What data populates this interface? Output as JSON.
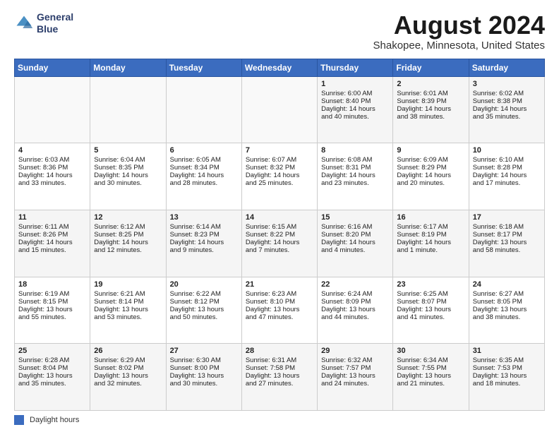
{
  "header": {
    "logo_line1": "General",
    "logo_line2": "Blue",
    "month_title": "August 2024",
    "location": "Shakopee, Minnesota, United States"
  },
  "days_of_week": [
    "Sunday",
    "Monday",
    "Tuesday",
    "Wednesday",
    "Thursday",
    "Friday",
    "Saturday"
  ],
  "weeks": [
    [
      {
        "day": "",
        "info": ""
      },
      {
        "day": "",
        "info": ""
      },
      {
        "day": "",
        "info": ""
      },
      {
        "day": "",
        "info": ""
      },
      {
        "day": "1",
        "info": "Sunrise: 6:00 AM\nSunset: 8:40 PM\nDaylight: 14 hours\nand 40 minutes."
      },
      {
        "day": "2",
        "info": "Sunrise: 6:01 AM\nSunset: 8:39 PM\nDaylight: 14 hours\nand 38 minutes."
      },
      {
        "day": "3",
        "info": "Sunrise: 6:02 AM\nSunset: 8:38 PM\nDaylight: 14 hours\nand 35 minutes."
      }
    ],
    [
      {
        "day": "4",
        "info": "Sunrise: 6:03 AM\nSunset: 8:36 PM\nDaylight: 14 hours\nand 33 minutes."
      },
      {
        "day": "5",
        "info": "Sunrise: 6:04 AM\nSunset: 8:35 PM\nDaylight: 14 hours\nand 30 minutes."
      },
      {
        "day": "6",
        "info": "Sunrise: 6:05 AM\nSunset: 8:34 PM\nDaylight: 14 hours\nand 28 minutes."
      },
      {
        "day": "7",
        "info": "Sunrise: 6:07 AM\nSunset: 8:32 PM\nDaylight: 14 hours\nand 25 minutes."
      },
      {
        "day": "8",
        "info": "Sunrise: 6:08 AM\nSunset: 8:31 PM\nDaylight: 14 hours\nand 23 minutes."
      },
      {
        "day": "9",
        "info": "Sunrise: 6:09 AM\nSunset: 8:29 PM\nDaylight: 14 hours\nand 20 minutes."
      },
      {
        "day": "10",
        "info": "Sunrise: 6:10 AM\nSunset: 8:28 PM\nDaylight: 14 hours\nand 17 minutes."
      }
    ],
    [
      {
        "day": "11",
        "info": "Sunrise: 6:11 AM\nSunset: 8:26 PM\nDaylight: 14 hours\nand 15 minutes."
      },
      {
        "day": "12",
        "info": "Sunrise: 6:12 AM\nSunset: 8:25 PM\nDaylight: 14 hours\nand 12 minutes."
      },
      {
        "day": "13",
        "info": "Sunrise: 6:14 AM\nSunset: 8:23 PM\nDaylight: 14 hours\nand 9 minutes."
      },
      {
        "day": "14",
        "info": "Sunrise: 6:15 AM\nSunset: 8:22 PM\nDaylight: 14 hours\nand 7 minutes."
      },
      {
        "day": "15",
        "info": "Sunrise: 6:16 AM\nSunset: 8:20 PM\nDaylight: 14 hours\nand 4 minutes."
      },
      {
        "day": "16",
        "info": "Sunrise: 6:17 AM\nSunset: 8:19 PM\nDaylight: 14 hours\nand 1 minute."
      },
      {
        "day": "17",
        "info": "Sunrise: 6:18 AM\nSunset: 8:17 PM\nDaylight: 13 hours\nand 58 minutes."
      }
    ],
    [
      {
        "day": "18",
        "info": "Sunrise: 6:19 AM\nSunset: 8:15 PM\nDaylight: 13 hours\nand 55 minutes."
      },
      {
        "day": "19",
        "info": "Sunrise: 6:21 AM\nSunset: 8:14 PM\nDaylight: 13 hours\nand 53 minutes."
      },
      {
        "day": "20",
        "info": "Sunrise: 6:22 AM\nSunset: 8:12 PM\nDaylight: 13 hours\nand 50 minutes."
      },
      {
        "day": "21",
        "info": "Sunrise: 6:23 AM\nSunset: 8:10 PM\nDaylight: 13 hours\nand 47 minutes."
      },
      {
        "day": "22",
        "info": "Sunrise: 6:24 AM\nSunset: 8:09 PM\nDaylight: 13 hours\nand 44 minutes."
      },
      {
        "day": "23",
        "info": "Sunrise: 6:25 AM\nSunset: 8:07 PM\nDaylight: 13 hours\nand 41 minutes."
      },
      {
        "day": "24",
        "info": "Sunrise: 6:27 AM\nSunset: 8:05 PM\nDaylight: 13 hours\nand 38 minutes."
      }
    ],
    [
      {
        "day": "25",
        "info": "Sunrise: 6:28 AM\nSunset: 8:04 PM\nDaylight: 13 hours\nand 35 minutes."
      },
      {
        "day": "26",
        "info": "Sunrise: 6:29 AM\nSunset: 8:02 PM\nDaylight: 13 hours\nand 32 minutes."
      },
      {
        "day": "27",
        "info": "Sunrise: 6:30 AM\nSunset: 8:00 PM\nDaylight: 13 hours\nand 30 minutes."
      },
      {
        "day": "28",
        "info": "Sunrise: 6:31 AM\nSunset: 7:58 PM\nDaylight: 13 hours\nand 27 minutes."
      },
      {
        "day": "29",
        "info": "Sunrise: 6:32 AM\nSunset: 7:57 PM\nDaylight: 13 hours\nand 24 minutes."
      },
      {
        "day": "30",
        "info": "Sunrise: 6:34 AM\nSunset: 7:55 PM\nDaylight: 13 hours\nand 21 minutes."
      },
      {
        "day": "31",
        "info": "Sunrise: 6:35 AM\nSunset: 7:53 PM\nDaylight: 13 hours\nand 18 minutes."
      }
    ]
  ],
  "footer": {
    "legend_label": "Daylight hours"
  }
}
